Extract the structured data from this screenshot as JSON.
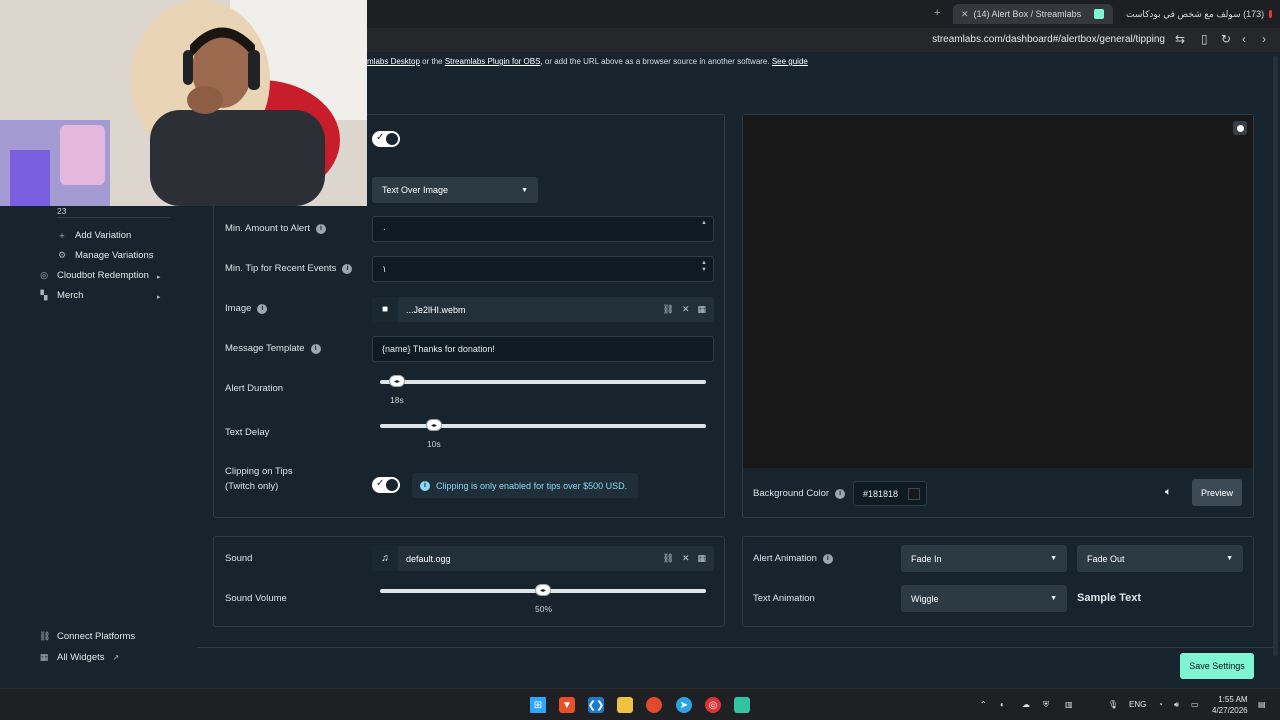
{
  "browser": {
    "tabs": [
      {
        "label": "(14) Alert Box / Streamlabs",
        "active": true
      },
      {
        "label": "(173) سولف مع شخص في بودكاست",
        "active": false
      }
    ],
    "new_tab_icon": "plus-icon",
    "url": "streamlabs.com/dashboard#/alertbox/general/tipping"
  },
  "notice": {
    "prefix": "mlabs Desktop",
    "middle1": " or the ",
    "link2": "Streamlabs Plugin for OBS",
    "middle2": ", or add the URL above as a browser source in another software. ",
    "link3": "See guide"
  },
  "sidebar": {
    "count_label": "23",
    "add_variation": "Add Variation",
    "manage_variations": "Manage Variations",
    "cloudbot": "Cloudbot Redemption",
    "merch": "Merch",
    "connect_platforms": "Connect Platforms",
    "all_widgets": "All Widgets"
  },
  "settings": {
    "layout_select": "Text Over Image",
    "min_amount_label": "Min. Amount to Alert",
    "min_amount_value": "۰",
    "min_tip_label": "Min. Tip for Recent Events",
    "min_tip_value": "١",
    "image_label": "Image",
    "image_file": "...Je2lHI.webm",
    "message_label": "Message Template",
    "message_value": "{name} Thanks for donation!",
    "alert_duration_label": "Alert Duration",
    "alert_duration_value": "18s",
    "alert_duration_fraction": 0.05,
    "text_delay_label": "Text Delay",
    "text_delay_value": "10s",
    "text_delay_fraction": 0.17,
    "clipping_label_1": "Clipping on Tips",
    "clipping_label_2": "(Twitch only)",
    "clipping_info": "Clipping is only enabled for tips over $500 USD."
  },
  "sound": {
    "sound_label": "Sound",
    "sound_file": "default.ogg",
    "volume_label": "Sound Volume",
    "volume_value": "50%",
    "volume_fraction": 0.5
  },
  "preview": {
    "bg_color_label": "Background Color",
    "bg_color_value": "#181818",
    "preview_button": "Preview"
  },
  "animation": {
    "alert_animation_label": "Alert Animation",
    "fade_in": "Fade In",
    "fade_out": "Fade Out",
    "text_animation_label": "Text Animation",
    "text_animation_value": "Wiggle",
    "sample_text": "Sample Text"
  },
  "save_button": "Save Settings",
  "taskbar": {
    "lang": "ENG",
    "time": "1:55 AM",
    "date": "4/27/2026"
  },
  "colors": {
    "page_bg": "#17242d",
    "accent_green": "#80f5d2",
    "preview_bg": "#181818"
  }
}
